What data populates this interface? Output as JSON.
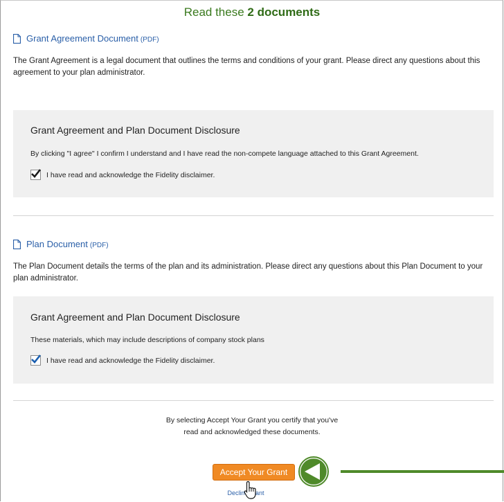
{
  "header": {
    "title_prefix": "Read these",
    "title_strong": "2 documents"
  },
  "documents": [
    {
      "link_label": "Grant Agreement Document",
      "link_suffix": "(PDF)",
      "description": "The Grant Agreement is a legal document that outlines the terms and conditions of your grant. Please direct any questions about this agreement to your plan administrator.",
      "panel": {
        "heading": "Grant Agreement and Plan Document Disclosure",
        "text": "By clicking \"I agree\" I confirm I understand and I have read the non-compete language attached to this Grant Agreement.",
        "checkbox_label": "I have read and acknowledge the Fidelity disclaimer.",
        "checkbox_checked": true
      }
    },
    {
      "link_label": "Plan Document",
      "link_suffix": "(PDF)",
      "description": "The Plan Document details the terms of the plan and its administration. Please direct any questions about this Plan Document to your plan administrator.",
      "panel": {
        "heading": "Grant Agreement and Plan Document Disclosure",
        "text": "These materials, which may include descriptions of company stock plans",
        "checkbox_label": "I have read and acknowledge the Fidelity disclaimer.",
        "checkbox_checked": true
      }
    }
  ],
  "footer": {
    "certify_line1": "By selecting Accept Your Grant you certify that you've",
    "certify_line2": "read and acknowledged these documents.",
    "accept_label": "Accept Your Grant",
    "decline_label": "Decline grant"
  },
  "colors": {
    "title_green": "#3a7a1e",
    "link_blue": "#2a5fa8",
    "accept_orange": "#f08a24",
    "annotation_green": "#4f8a2a",
    "panel_gray": "#f0f0f0"
  },
  "icons": [
    "document-icon",
    "checkmark-icon",
    "hand-pointer-icon",
    "annotation-arrow-icon"
  ]
}
